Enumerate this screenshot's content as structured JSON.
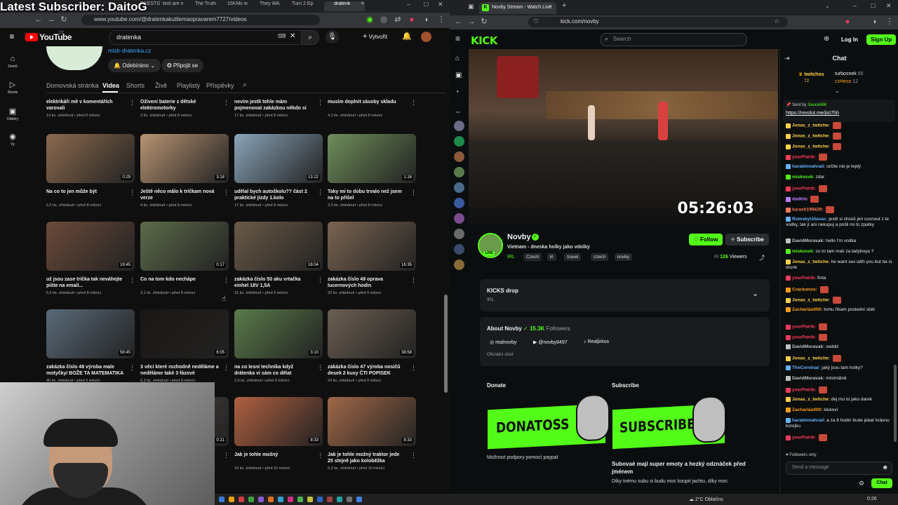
{
  "overlay": {
    "subscriber_banner": "Latest Subscriber: DaitoG"
  },
  "left_browser": {
    "tabs": [
      "PRESTIŽ",
      "bird are n",
      "The Truth",
      "15KMs w",
      "They WA",
      "Turn 2 Ep",
      "dratenk"
    ],
    "url": "www.youtube.com/@dratenkakutilemaopravarem7727/videos",
    "youtube": {
      "logo_text": "YouTube",
      "logo_sup": "CZ",
      "search_value": "dratenka",
      "create_label": "Vytvořit",
      "sidebar": [
        {
          "label": "Domů",
          "icon": "home-icon"
        },
        {
          "label": "Shorts",
          "icon": "shorts-icon"
        },
        {
          "label": "Odběry",
          "icon": "subscriptions-icon"
        },
        {
          "label": "Vy",
          "icon": "you-icon"
        }
      ],
      "channel_link": "mistr-dratenka.cz",
      "subscribed_label": "Odebíráno",
      "join_label": "Připojit se",
      "channel_tabs": [
        "Domovská stránka",
        "Videa",
        "Shorts",
        "Živě",
        "Playlisty",
        "Příspěvky"
      ],
      "active_tab": "Videa",
      "top_row": [
        {
          "title": "elektrikáři mě v komentářích varovali",
          "meta": "14 tis. zhlédnutí • před 8 měsíci"
        },
        {
          "title": "Oživení baterie z dětské elektromotorky",
          "meta": "3 tis. zhlédnutí • před 8 měsíci"
        },
        {
          "title": "nevím jestli tohle mám pojmenovat zakázkou někdo si ze mě asi střílí",
          "meta": "17 tis. zhlédnutí • před 8 měsíci"
        },
        {
          "title": "musím doplnit zásoby skladu",
          "meta": "4,2 tis. zhlédnutí • před 8 měsíci"
        }
      ],
      "videos": [
        {
          "title": "Na co to jen může být",
          "meta": "6,5 tis. zhlédnutí • před 8 měsíci",
          "duration": "0:29",
          "thumb": "#8c6a4e"
        },
        {
          "title": "Ještě něco málo k tričkam nová verze",
          "meta": "4 tis. zhlédnutí • před 8 měsíci",
          "duration": "3:18",
          "thumb": "#b89472"
        },
        {
          "title": "udělal bych autoškolu?? část 2 praktické jízdy 1.kolo",
          "meta": "17 tis. zhlédnutí • před 8 měsíci",
          "duration": "13:22",
          "thumb": "#8aa4b8"
        },
        {
          "title": "Taky mi to dobu trvalo než jsem na to přišel",
          "meta": "3,9 tis. zhlédnutí • před 8 měsíci",
          "duration": "1:16",
          "thumb": "#6f8d5a"
        },
        {
          "title": "už jsou zase trička tak neváhejte pište na email...",
          "meta": "5,6 tis. zhlédnutí • před 8 měsíci",
          "duration": "18:45",
          "thumb": "#6b4a3a"
        },
        {
          "title": "Co na tom kdo nechápe",
          "meta": "3,1 tis. zhlédnutí • před 8 měsíci",
          "duration": "0:17",
          "thumb": "#5d6b4a"
        },
        {
          "title": "zakázka číslo 50 aku vrtačka einhel 18V 1,5A",
          "meta": "31 tis. zhlédnutí • před 9 měsíci",
          "duration": "16:04",
          "thumb": "#6a5a48"
        },
        {
          "title": "zakázka číslo 49 oprava lucernových hodin",
          "meta": "20 tis. zhlédnutí • před 9 měsíci",
          "duration": "16:35",
          "thumb": "#7a6452"
        },
        {
          "title": "zakázka číslo 48 výroba male motyčky/ BOŽE TA MATEMATIKA",
          "meta": "40 tis. zhlédnutí • před 9 měsíci",
          "duration": "58:45",
          "thumb": "#5a6a78"
        },
        {
          "title": "3 věci které rozhodně neděláme a neděláme také 3 fázové spotřebiče",
          "meta": "5,3 tis. zhlédnutí • před 9 měsíci",
          "duration": "6:05",
          "thumb": "#1a1714"
        },
        {
          "title": "na co lesní technika když drátenka ví sám co dělat",
          "meta": "2,6 tis. zhlédnutí • před 9 měsíci",
          "duration": "3:10",
          "thumb": "#5a7a4a"
        },
        {
          "title": "zakázka číslo 47 výroba nosičů desek 2 kusy ČTI POPISEK",
          "meta": "24 tis. zhlédnutí • před 9 měsíci",
          "duration": "38:58",
          "thumb": "#6a5e52"
        },
        {
          "title": "",
          "meta": "",
          "duration": "0:21",
          "thumb": "#4a4440"
        },
        {
          "title": "Jak je tohle možný",
          "meta": "10 tis. zhlédnutí • před 10 měsíci",
          "duration": "8:33",
          "thumb": "#b06040"
        },
        {
          "title": "Jak je tohle možný traktor jede 25 stejně jako koloběžka elektrická",
          "meta": "5,3 tis. zhlédnutí • před 10 měsíci",
          "duration": "8:33",
          "thumb": "#a06848"
        }
      ]
    }
  },
  "right_browser": {
    "tab_title": "Novby Stream - Watch Live",
    "url": "kick.com/novby",
    "search_placeholder": "Search",
    "login_label": "Log In",
    "signup_label": "Sign Up",
    "timer": "05:26:03",
    "streamer": {
      "name": "Novby",
      "live_label": "LIVE",
      "title": "Vietnam - dneska holky jako vdolky",
      "category": "IRL",
      "tags": [
        "Czech",
        "irl",
        "travel",
        "czech",
        "novby"
      ],
      "follow_label": "Follow",
      "subscribe_label": "Subscribe",
      "viewers": "126",
      "viewers_label": "Viewers"
    },
    "drops": {
      "title": "KICKS drop",
      "sub": "IRL"
    },
    "about": {
      "title": "About Novby",
      "followers": "15.3K",
      "followers_label": "Followers",
      "socials": [
        "realnovby",
        "@novby8497",
        "Realjirkos"
      ],
      "official": "Oficiální účet"
    },
    "donate": {
      "title": "Donate",
      "banner": "DONATOSS",
      "caption": "Možnost podpory pomocí paypal"
    },
    "subscribe_panel": {
      "title": "Subscribe",
      "banner": "SUBSCRIBE",
      "caption": "Subovaé mají super emoty a hezký odznáček před jménem",
      "caption2": "Díky tvému subu si budu moc koupit jachtu, díky moc."
    },
    "chat": {
      "title": "Chat",
      "top_gifters": [
        {
          "name": "twitchos",
          "count": "72"
        },
        {
          "name": "turbosnek",
          "count": "65"
        },
        {
          "name": "czHeso",
          "count": "12"
        }
      ],
      "pinned_by": "Sent by",
      "pinned_user": "Sauce666",
      "pinned_link": "https://revolut.me/jist7hh",
      "messages": [
        {
          "user": "Jonas_z_twitche:",
          "text": "",
          "color": "#ffd24a"
        },
        {
          "user": "Jonas_z_twitche:",
          "text": "",
          "color": "#ffd24a"
        },
        {
          "user": "Jonas_z_twitche:",
          "text": "",
          "color": "#ffd24a"
        },
        {
          "user": "yourPatrik:",
          "text": "",
          "color": "#ff3b5c"
        },
        {
          "user": "harabinnahrad:",
          "text": "určite nie je teplý",
          "color": "#66b3ff"
        },
        {
          "user": "miskosvk:",
          "text": "zdar",
          "color": "#53fc18"
        },
        {
          "user": "yourPatrik:",
          "text": "",
          "color": "#ff3b5c"
        },
        {
          "user": "dadklic",
          "text": "",
          "color": "#b980ff"
        },
        {
          "user": "lucash199429:",
          "text": "",
          "color": "#ff7a59"
        },
        {
          "user": "RomskyUdavac:",
          "text": "jestli si chceš jen cucnout z te vodky, tak jí ani nekupuj a pošli mi to zpatky",
          "color": "#66b3ff"
        },
        {
          "user": "DavidMoravak:",
          "text": "hello I'm vodka",
          "color": "#c0c0c0"
        },
        {
          "user": "miskosvk:",
          "text": "co to tam maš za ladyboya ?",
          "color": "#53fc18"
        },
        {
          "user": "Jonas_z_twitche:",
          "text": "he want sex with you but he is drunk",
          "color": "#ffd24a"
        },
        {
          "user": "yourPatrik:",
          "text": "finta",
          "color": "#ff3b5c"
        },
        {
          "user": "Crackonos:",
          "text": "",
          "color": "#ff9f1a"
        },
        {
          "user": "Jonas_z_twitche:",
          "text": "",
          "color": "#ffd24a"
        },
        {
          "user": "Zachariás000:",
          "text": "tomu říkam poslední sběr",
          "color": "#ff9f1a"
        },
        {
          "user": "yourPatrik:",
          "text": "",
          "color": "#ff3b5c"
        },
        {
          "user": "yourPatrik:",
          "text": "",
          "color": "#ff3b5c"
        },
        {
          "user": "DavidMoravak:",
          "text": "xeddd",
          "color": "#c0c0c0"
        },
        {
          "user": "Jonas_z_twitche:",
          "text": "",
          "color": "#ffd24a"
        },
        {
          "user": "TheCorvinar:",
          "text": "jaký jsou tam holky?",
          "color": "#66b3ff"
        },
        {
          "user": "DavidMoravak:",
          "text": "minimálně",
          "color": "#c0c0c0"
        },
        {
          "user": "yourPatrik:",
          "text": "",
          "color": "#ff3b5c"
        },
        {
          "user": "Jonas_z_twitche:",
          "text": "dej mu to jako darek",
          "color": "#ffd24a"
        },
        {
          "user": "Zachariás000:",
          "text": "klukoví",
          "color": "#ff9f1a"
        },
        {
          "user": "harabinnahrad:",
          "text": "a za 8 hodin bude jebať krásnu korejku",
          "color": "#66b3ff"
        },
        {
          "user": "yourPatrik:",
          "text": "",
          "color": "#ff3b5c"
        }
      ],
      "followers_only": "Followers only",
      "input_placeholder": "Send a message",
      "send_label": "Chat"
    }
  },
  "taskbar": {
    "weather": "2°C Oblačno",
    "time": "0:26"
  },
  "colors": {
    "kick_green": "#53fc18",
    "yt_red": "#ff0000",
    "link_blue": "#3ea6ff"
  }
}
